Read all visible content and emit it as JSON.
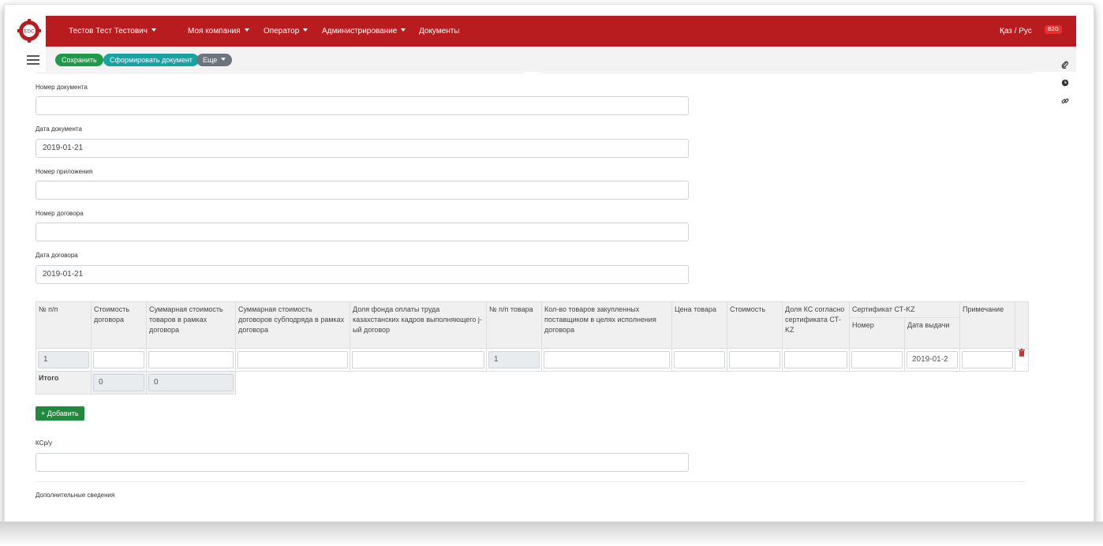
{
  "header": {
    "user_name": "Тестов Тест Тестович",
    "menu": [
      "Моя компания",
      "Оператор",
      "Администрирование",
      "Документы"
    ],
    "lang": "Қаз / Рус",
    "badge": "B2G"
  },
  "toolbar": {
    "save_label": "Сохранить",
    "generate_label": "Сформировать документ",
    "more_label": "Еще"
  },
  "form": {
    "doc_number_label": "Номер документа",
    "doc_number_value": "",
    "doc_date_label": "Дата документа",
    "doc_date_value": "2019-01-21",
    "appendix_label": "Номер приложения",
    "appendix_value": "",
    "contract_number_label": "Номер договора",
    "contract_number_value": "",
    "contract_date_label": "Дата договора",
    "contract_date_value": "2019-01-21",
    "ksr_label": "КСр/у",
    "extra_label": "Дополнительные сведения"
  },
  "table": {
    "headers": {
      "num": "№ п/п",
      "contract_cost": "Стоимость договора",
      "total_goods": "Суммарная стоимость товаров в рамках договора",
      "total_sub": "Суммарная стоимость договоров субподряда в рамках договора",
      "fund_share": "Доля фонда оплаты труда казахстанских кадров выполняющего j-ый договор",
      "goods_num": "№ п/п товара",
      "goods_qty": "Кол-во товаров закупленных поставщиком в целях исполнения договора",
      "price": "Цена товара",
      "cost": "Стоимость",
      "kc_share": "Доля КС согласно сертификата СТ-KZ",
      "cert": "Сертификат СТ-KZ",
      "cert_number": "Номер",
      "cert_date": "Дата выдачи",
      "note": "Примечание"
    },
    "row": {
      "num": "1",
      "goods_num": "1",
      "cert_date": "2019-01-2"
    },
    "total_label": "Итого",
    "total_contract": "0",
    "total_goods": "0"
  },
  "add_label": "+ Добавить"
}
